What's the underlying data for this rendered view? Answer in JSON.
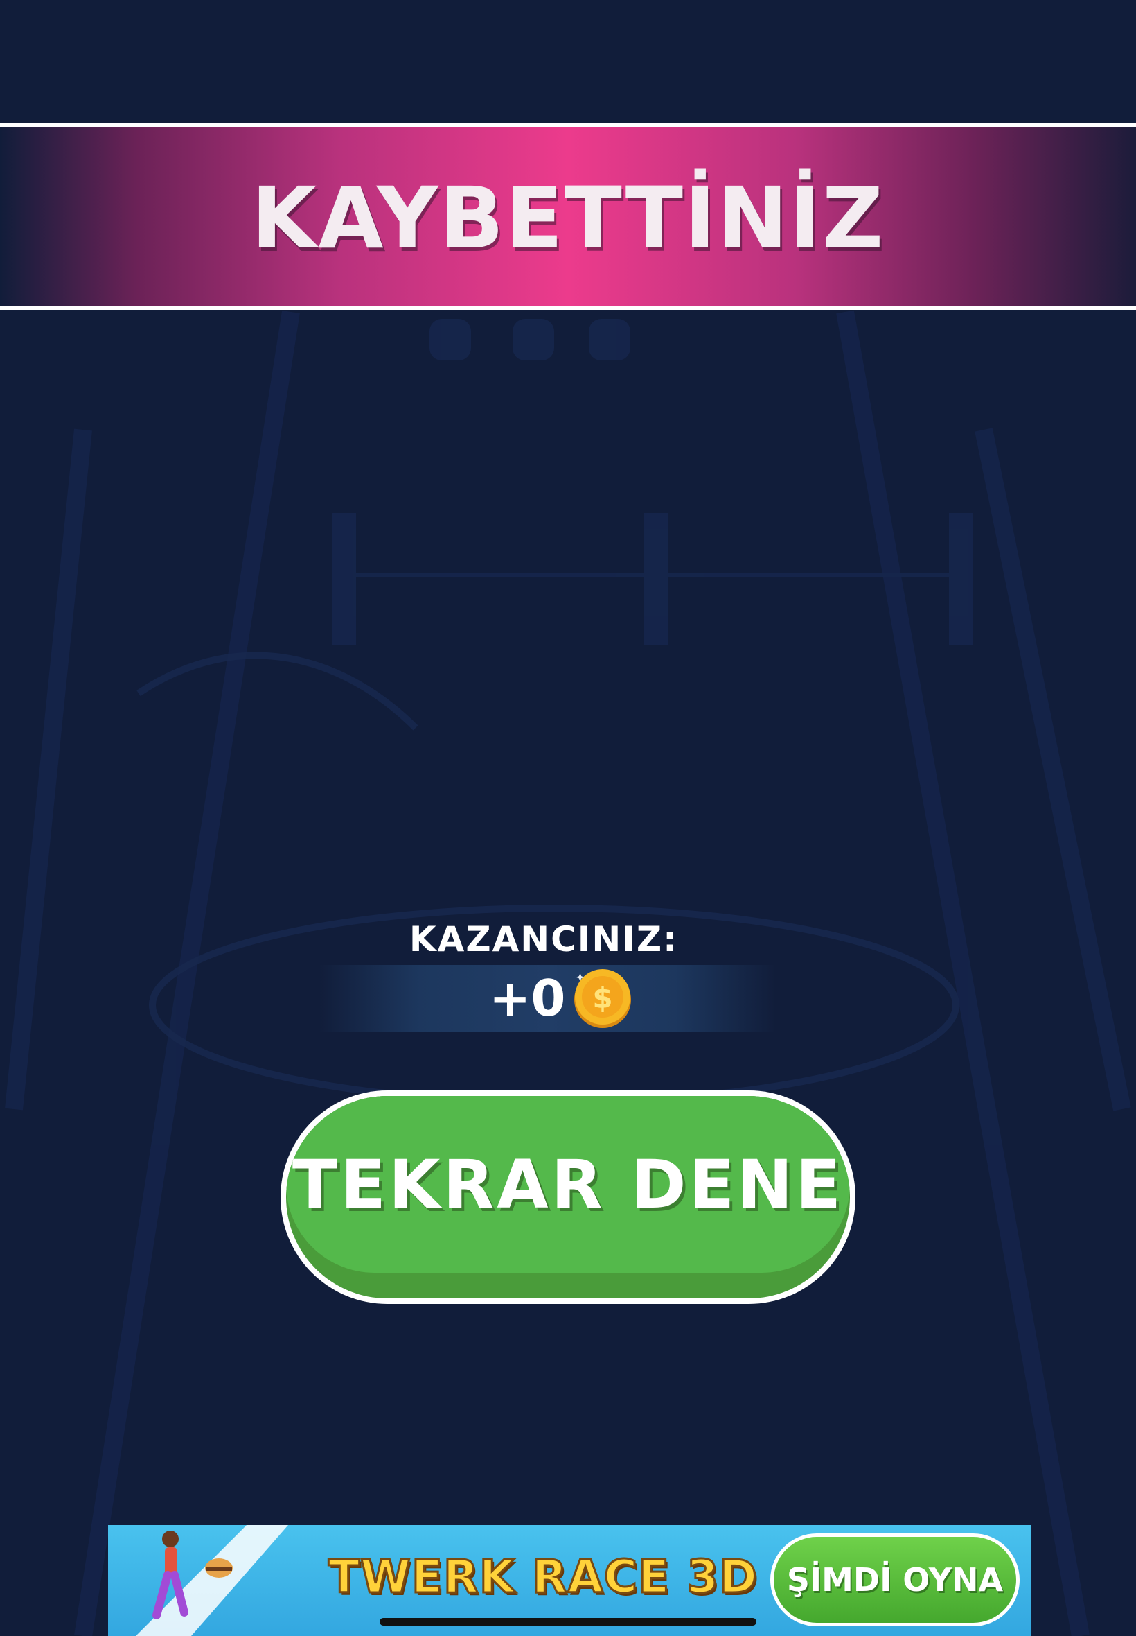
{
  "banner": {
    "title": "KAYBETTİNİZ"
  },
  "earnings": {
    "label": "KAZANCINIZ:",
    "value": "+0",
    "icon": "coin-icon"
  },
  "retry_button": {
    "label": "TEKRAR DENE"
  },
  "ad": {
    "title": "TWERK RACE 3D",
    "cta": "ŞİMDİ OYNA"
  },
  "colors": {
    "background": "#111d3a",
    "banner_accent": "#ec3b8c",
    "retry_green": "#54b94b",
    "coin_gold": "#f7b824"
  }
}
